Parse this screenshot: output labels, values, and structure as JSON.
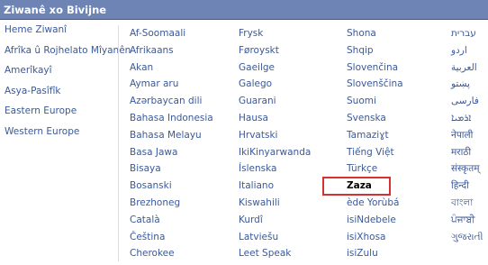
{
  "header": {
    "title": "Ziwanê xo Bivijne"
  },
  "regions": [
    "Heme Ziwanî",
    "Afrîka û Rojhelato Mîyanên",
    "Amerîkayî",
    "Asya-Pasîfîk",
    "Eastern Europe",
    "Western Europe"
  ],
  "languages": {
    "col1": [
      "Af-Soomaali",
      "Afrikaans",
      "Akan",
      "Aymar aru",
      "Azərbaycan dili",
      "Bahasa Indonesia",
      "Bahasa Melayu",
      "Basa Jawa",
      "Bisaya",
      "Bosanski",
      "Brezhoneg",
      "Català",
      "Čeština",
      "Cherokee"
    ],
    "col2": [
      "Frysk",
      "Føroyskt",
      "Gaeilge",
      "Galego",
      "Guarani",
      "Hausa",
      "Hrvatski",
      "IkiKinyarwanda",
      "Íslenska",
      "Italiano",
      "Kiswahili",
      "Kurdî",
      "Latviešu",
      "Leet Speak"
    ],
    "col3": [
      "Shona",
      "Shqip",
      "Slovenčina",
      "Slovenščina",
      "Suomi",
      "Svenska",
      "Tamaziɣt",
      "Tiếng Việt",
      "Türkçe",
      "Zaza",
      "ède Yorùbá",
      "isiNdebele",
      "isiXhosa",
      "isiZulu"
    ],
    "col4": [
      "עברית",
      "اردو",
      "العربية",
      "پښتو",
      "فارسی",
      "ܐܪܡܝܐ",
      "नेपाली",
      "मराठी",
      "संस्कृतम्",
      "हिन्दी",
      "বাংলা",
      "ਪੰਜਾਬੀ",
      "ગુજરાતી"
    ]
  },
  "state": {
    "hovered": "Türkçe",
    "selected": "Zaza"
  },
  "colors": {
    "header_bg": "#6d84b4",
    "link": "#3b5998",
    "highlight": "#d63131"
  }
}
